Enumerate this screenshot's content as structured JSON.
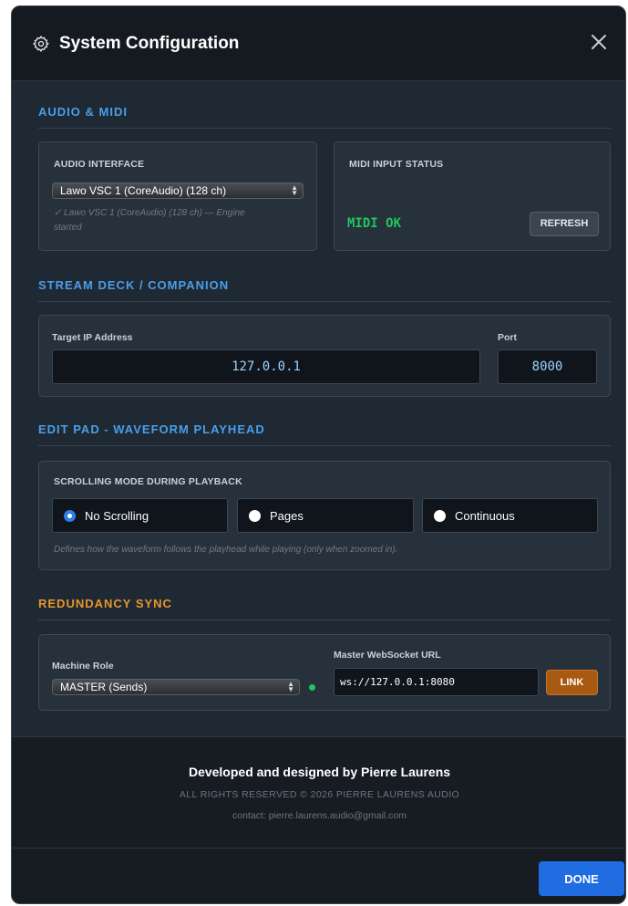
{
  "header": {
    "title": "System Configuration",
    "icon": "gear-icon",
    "close_icon": "close-icon"
  },
  "audio_midi": {
    "section_title": "AUDIO & MIDI",
    "audio_interface": {
      "label": "AUDIO INTERFACE",
      "selected": "Lawo VSC 1 (CoreAudio) (128 ch)",
      "status_line1": "✓ Lawo VSC 1 (CoreAudio) (128 ch) — Engine",
      "status_line2": "started"
    },
    "midi": {
      "label": "MIDI INPUT STATUS",
      "status": "MIDI OK",
      "status_color": "#22c55e",
      "refresh_label": "REFRESH"
    }
  },
  "stream_deck": {
    "section_title": "STREAM DECK / COMPANION",
    "ip_label": "Target IP Address",
    "ip_value": "127.0.0.1",
    "port_label": "Port",
    "port_value": "8000"
  },
  "edit_pad": {
    "section_title": "EDIT PAD - WAVEFORM PLAYHEAD",
    "mode_label": "SCROLLING MODE DURING PLAYBACK",
    "options": [
      {
        "label": "No Scrolling",
        "checked": true
      },
      {
        "label": "Pages",
        "checked": false
      },
      {
        "label": "Continuous",
        "checked": false
      }
    ],
    "note": "Defines how the waveform follows the playhead while playing (only when zoomed in)."
  },
  "redundancy": {
    "section_title": "REDUNDANCY SYNC",
    "role_label": "Machine Role",
    "role_selected": "MASTER (Sends)",
    "status_dot_color": "#22c55e",
    "url_label": "Master WebSocket URL",
    "url_value": "ws://127.0.0.1:8080",
    "link_label": "LINK"
  },
  "footer": {
    "credit": "Developed and designed by Pierre Laurens",
    "rights": "ALL RIGHTS RESERVED © 2026 PIERRE LAURENS AUDIO",
    "contact": "contact: pierre.laurens.audio@gmail.com",
    "done_label": "DONE"
  },
  "colors": {
    "accent_blue": "#4a9eea",
    "accent_orange": "#e8962a",
    "done_button": "#1f6de0",
    "link_button": "#a85a12"
  }
}
